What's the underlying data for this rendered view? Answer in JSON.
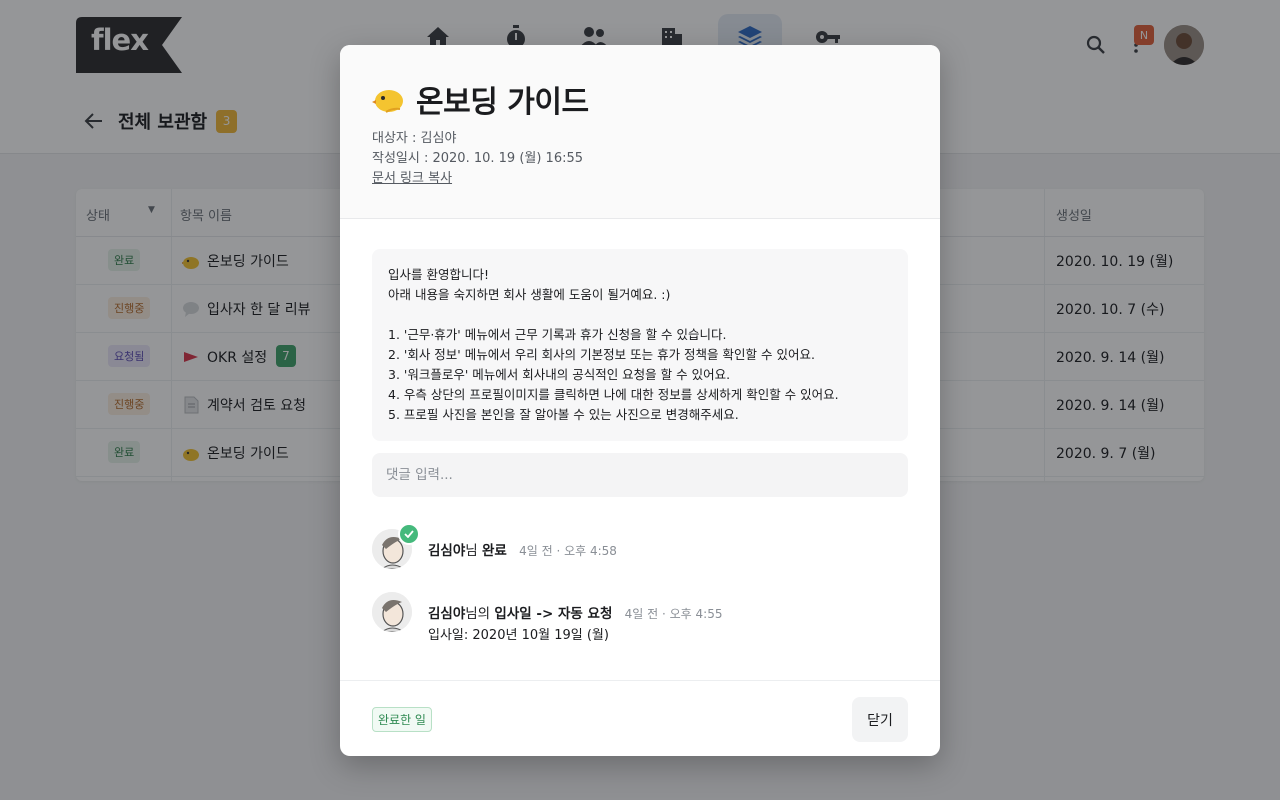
{
  "app": {
    "logo_text": "flex",
    "notification_badge": "N",
    "nav_icons": [
      "home-icon",
      "timer-icon",
      "people-icon",
      "building-icon",
      "layers-icon",
      "key-icon"
    ],
    "active_nav": "layers-icon"
  },
  "page": {
    "title": "전체 보관함",
    "count": "3"
  },
  "table": {
    "headers": {
      "status": "상태",
      "name": "항목 이름",
      "created": "생성일"
    },
    "rows": [
      {
        "status": "완료",
        "status_type": "done",
        "icon": "chick-icon",
        "name": "온보딩 가이드",
        "badge": "",
        "date": "2020. 10. 19 (월)"
      },
      {
        "status": "진행중",
        "status_type": "progress",
        "icon": "speech-bubble-icon",
        "name": "입사자 한 달 리뷰",
        "badge": "",
        "date": "2020. 10. 7 (수)"
      },
      {
        "status": "요청됨",
        "status_type": "requested",
        "icon": "flag-icon",
        "name": "OKR 설정",
        "badge": "7",
        "date": "2020. 9. 14 (월)"
      },
      {
        "status": "진행중",
        "status_type": "progress",
        "icon": "document-icon",
        "name": "계약서 검토 요청",
        "badge": "",
        "date": "2020. 9. 14 (월)"
      },
      {
        "status": "완료",
        "status_type": "done",
        "icon": "chick-icon",
        "name": "온보딩 가이드",
        "badge": "",
        "date": "2020. 9. 7 (월)"
      }
    ]
  },
  "modal": {
    "title": "온보딩 가이드",
    "target": "대상자 : 김심야",
    "written_at": "작성일시 : 2020. 10. 19 (월) 16:55",
    "copy_link": "문서 링크 복사",
    "body": "입사를 환영합니다!\n아래 내용을 숙지하면 회사 생활에 도움이 될거예요. :)\n\n1. '근무·휴가' 메뉴에서 근무 기록과 휴가 신청을 할 수 있습니다.\n2. '회사 정보' 메뉴에서 우리 회사의 기본정보 또는 휴가 정책을 확인할 수 있어요.\n3. '워크플로우' 메뉴에서 회사내의 공식적인 요청을 할 수 있어요.\n4. 우측 상단의 프로필이미지를 클릭하면 나에 대한 정보를 상세하게 확인할 수 있어요.\n5. 프로필 사진을 본인을 잘 알아볼 수 있는 사진으로 변경해주세요.",
    "comment_placeholder": "댓글 입력...",
    "activities": [
      {
        "name": "김심야",
        "suffix": "님",
        "action": "완료",
        "time": "4일 전 · 오후 4:58",
        "detail": ""
      },
      {
        "name": "김심야",
        "suffix": "님의",
        "action": "입사일 -> 자동 요청",
        "time": "4일 전 · 오후 4:55",
        "detail": "입사일: 2020년 10월 19일 (월)"
      }
    ],
    "done_tag": "완료한 일",
    "close_label": "닫기"
  }
}
